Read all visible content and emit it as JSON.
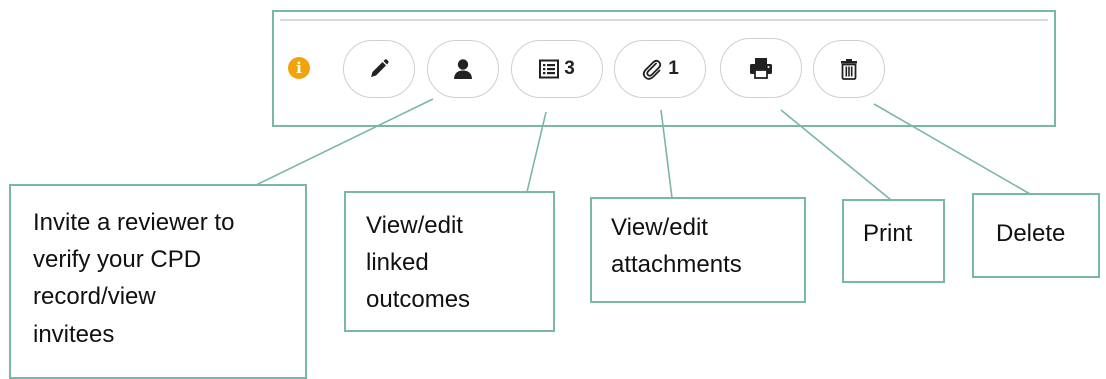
{
  "toolbar": {
    "icons": {
      "info": "info-icon",
      "edit": "pencil-icon",
      "invite": "user-icon",
      "outcomes": "list-icon",
      "attachments": "paperclip-icon",
      "print": "printer-icon",
      "delete": "trash-icon"
    },
    "info_glyph": "i",
    "outcomes_count": "3",
    "attachments_count": "1",
    "colors": {
      "info_badge": "#f0a30a",
      "frame_border": "#79b8a6",
      "pill_border": "#cfcfcf",
      "icon": "#222222"
    }
  },
  "callouts": {
    "invite": "Invite a reviewer to\nverify your CPD\nrecord/view\ninvitees",
    "outcomes": "View/edit\nlinked\noutcomes",
    "attachments": "View/edit\nattachments",
    "print": "Print",
    "delete": "Delete"
  }
}
